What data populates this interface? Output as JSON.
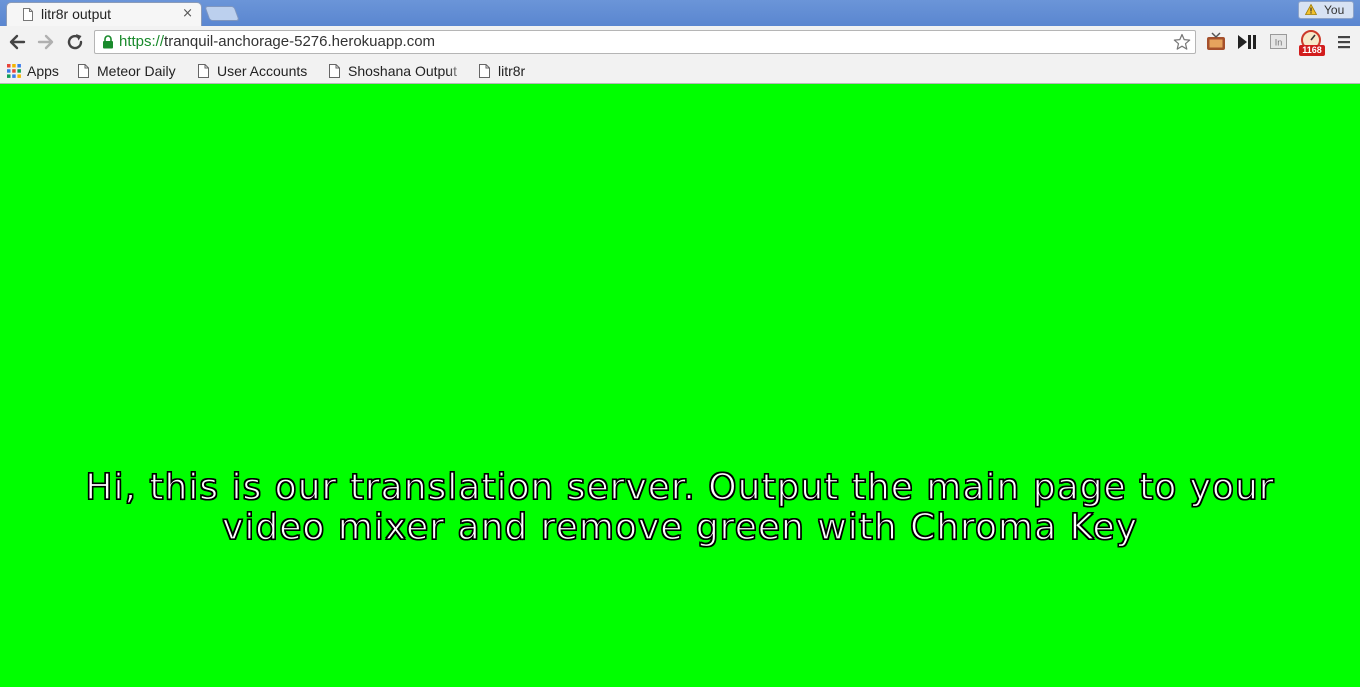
{
  "tab": {
    "title": "litr8r output",
    "close_glyph": "×",
    "icon": "file-icon"
  },
  "profile": {
    "label": "You",
    "icon": "warning-icon"
  },
  "toolbar": {
    "url_scheme": "https://",
    "url_host": "tranquil-anchorage-5276.herokuapp.com",
    "icons": [
      "back-arrow-icon",
      "forward-arrow-icon",
      "reload-icon",
      "lock-icon",
      "star-icon",
      "menu-icon"
    ],
    "extensions": [
      "tv-extension-icon",
      "play-pause-extension-icon",
      "in-extension-icon",
      "gauge-extension-icon"
    ],
    "extension_badge": "1168"
  },
  "bookmarks": [
    {
      "label": "Apps",
      "icon": "apps-grid-icon"
    },
    {
      "label": "Meteor Daily",
      "icon": "page-icon"
    },
    {
      "label": "User Accounts",
      "icon": "page-icon"
    },
    {
      "label": "Shoshana Output",
      "icon": "page-icon"
    },
    {
      "label": "litr8r",
      "icon": "page-icon"
    }
  ],
  "page": {
    "background_color": "#00ff00",
    "message_line1": "Hi, this is our translation server. Output the main page to your",
    "message_line2": "video mixer and remove green with Chroma Key"
  },
  "colors": {
    "tabstrip": "#5a86d0",
    "toolbar": "#f2f2f2",
    "secure_scheme": "#1a8a2c",
    "badge": "#d21d1d"
  }
}
